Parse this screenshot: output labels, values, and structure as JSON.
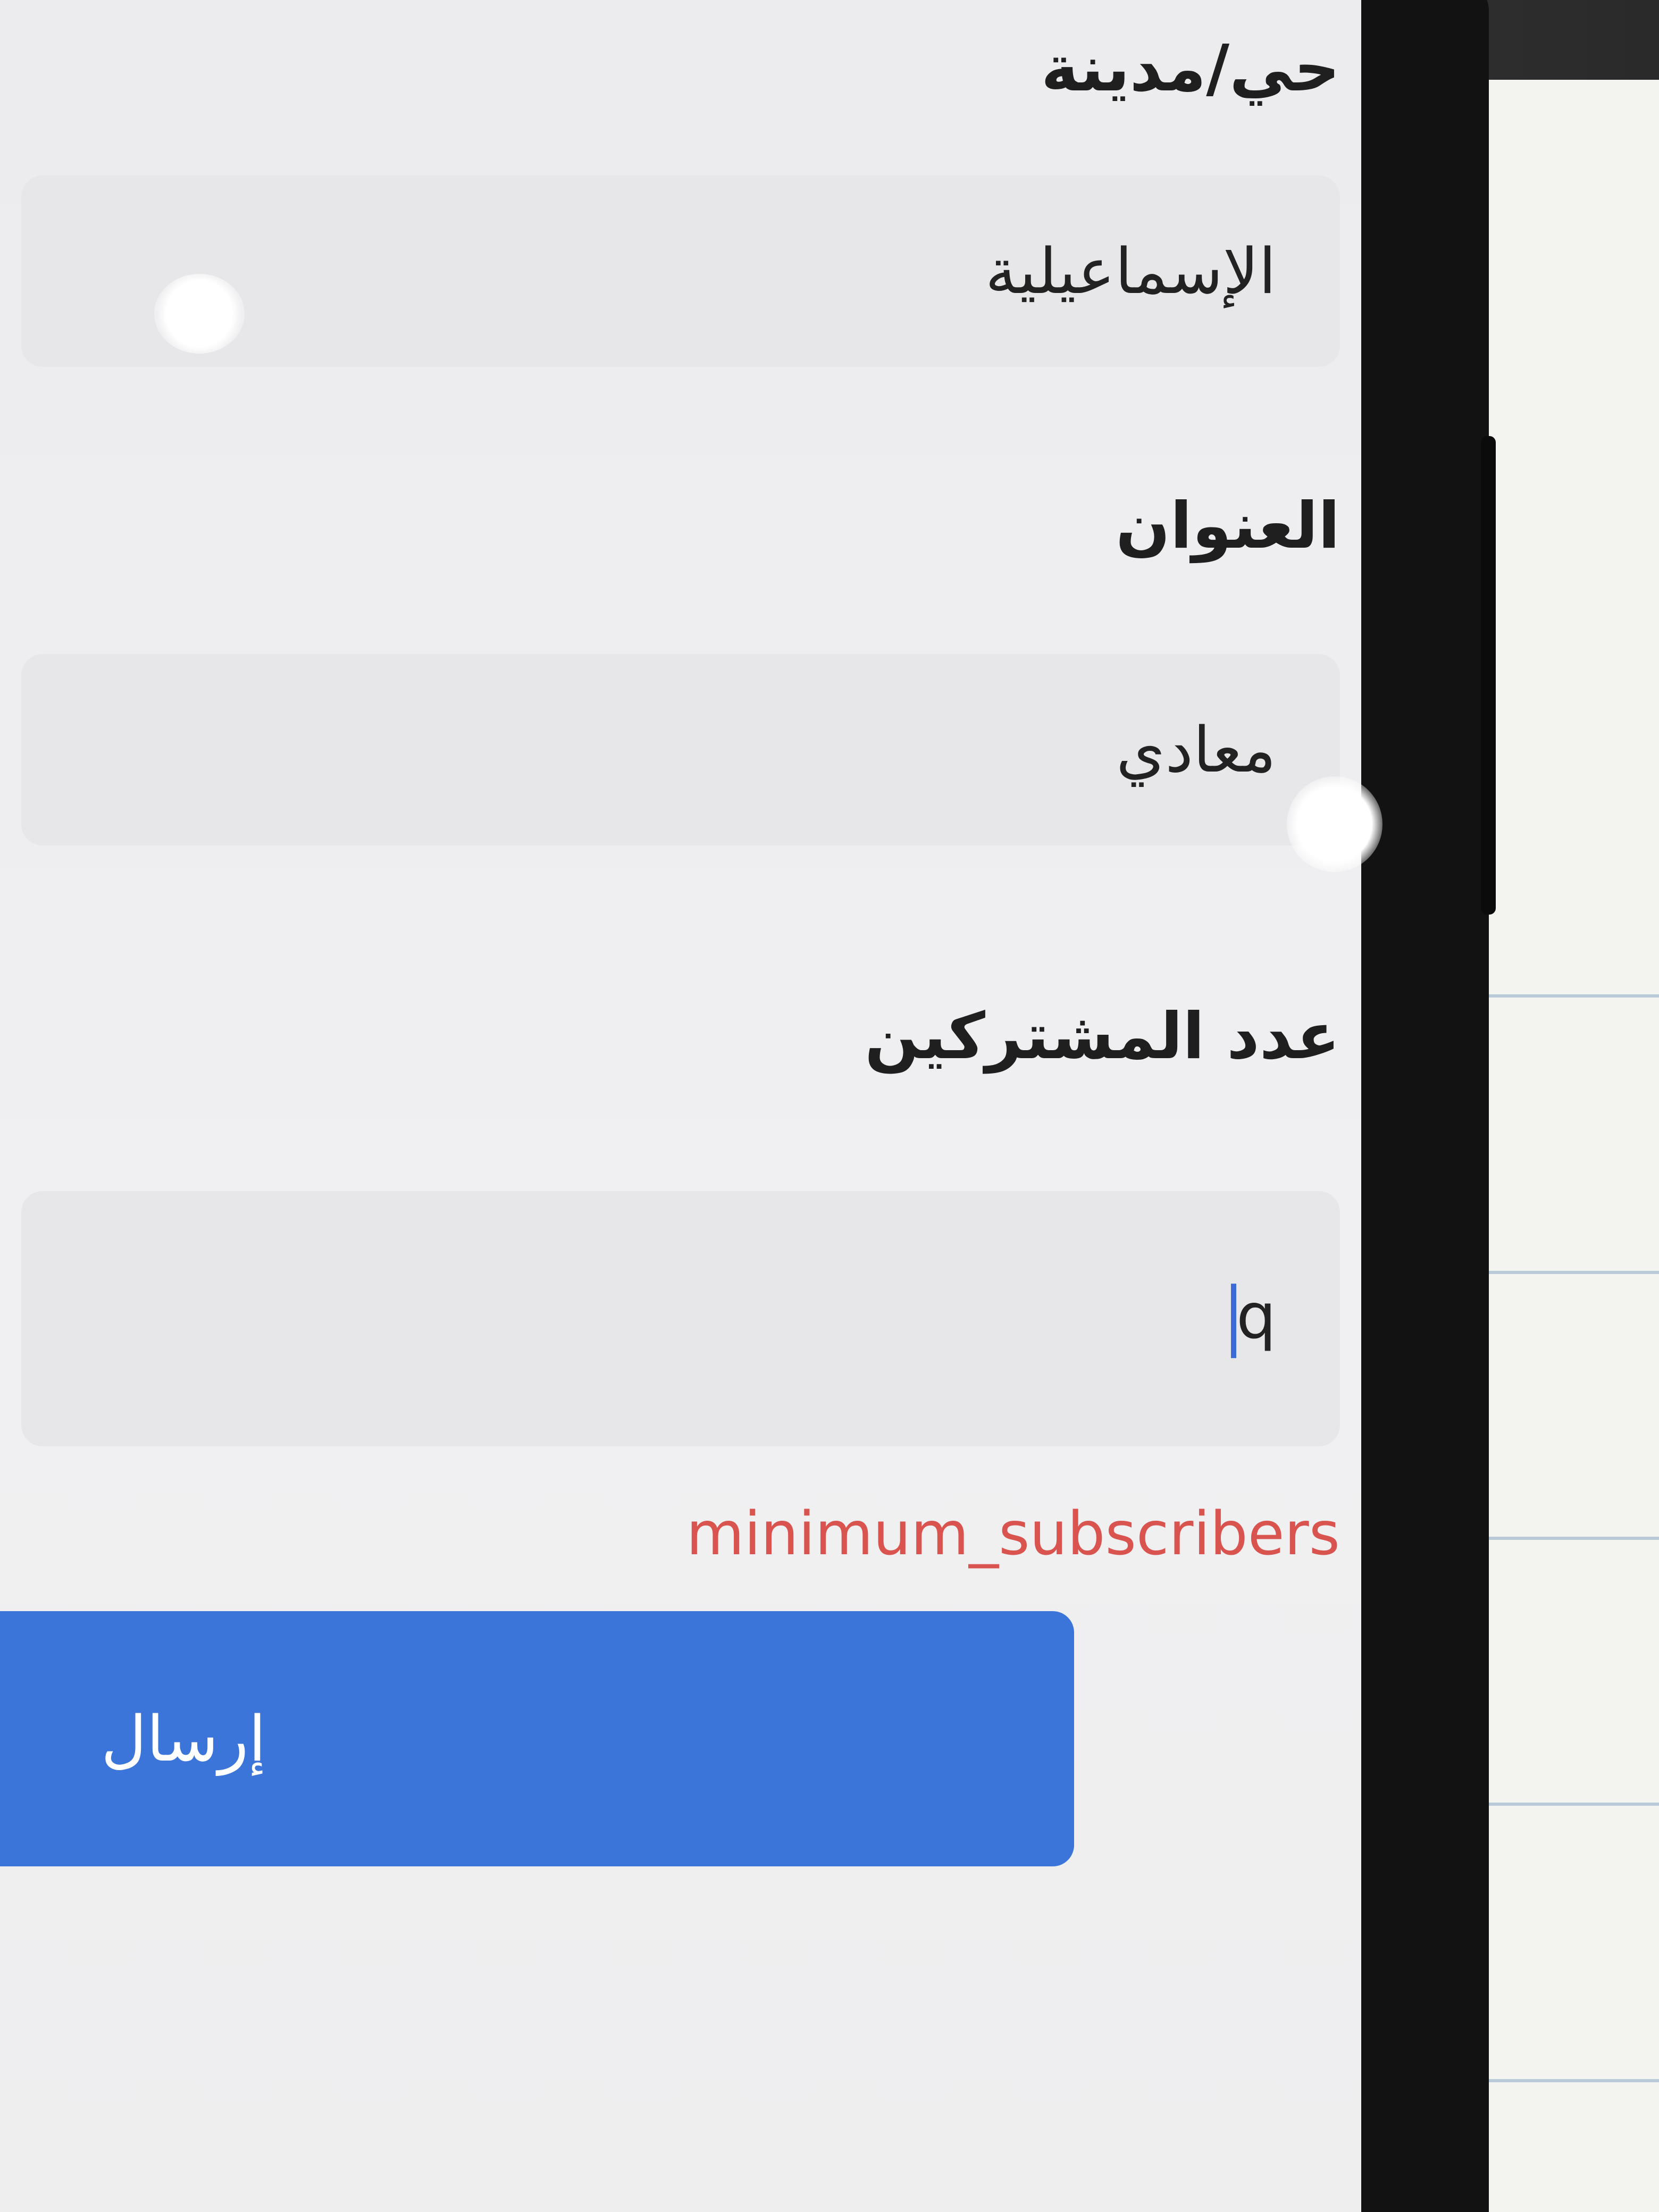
{
  "form": {
    "district_label": "حي/مدينة",
    "district_value": "الإسماعيلية",
    "address_label": "العنوان",
    "address_value": "معادي",
    "subscribers_label": "عدد المشتركين",
    "subscribers_value": "q",
    "subscribers_error": "minimum_subscribers",
    "submit_label": "إرسال"
  },
  "colors": {
    "accent": "#3c75d9",
    "error": "#d9534f",
    "field_bg": "#e7e7ea",
    "screen_bg": "#efeff1"
  }
}
